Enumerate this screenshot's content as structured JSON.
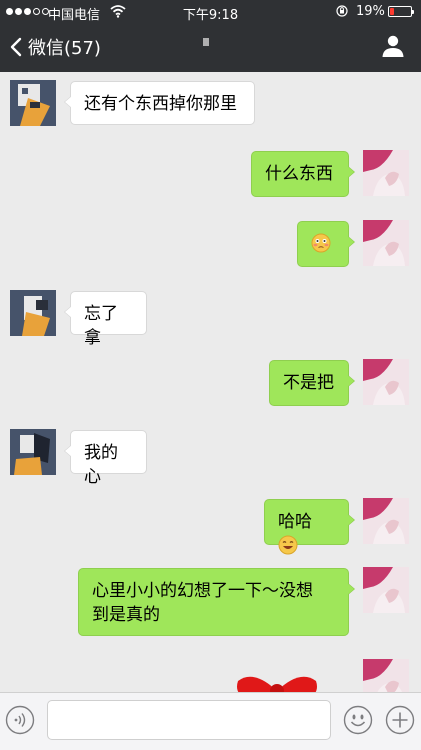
{
  "status_bar": {
    "carrier": "中国电信",
    "time": "下午9:18",
    "battery_percent": "19%",
    "battery_level": 0.19,
    "signal_bars": 3,
    "signal_total": 5,
    "colors": {
      "battery_low": "#ff3b30"
    }
  },
  "nav": {
    "back_label": "微信(57)",
    "icons": {
      "back": "chevron-left-icon",
      "contact": "person-icon"
    }
  },
  "colors": {
    "bubble_mine": "#9fe65a",
    "bubble_other": "#ffffff",
    "nav_bg": "#2f3134",
    "chat_bg": "#ebebeb"
  },
  "messages": [
    {
      "side": "left",
      "text": "还有个东西掉你那里"
    },
    {
      "side": "right",
      "text": "什么东西"
    },
    {
      "side": "right",
      "text": "",
      "emoji": "flushed-face-icon"
    },
    {
      "side": "left",
      "text": "忘了拿"
    },
    {
      "side": "right",
      "text": "不是把"
    },
    {
      "side": "left",
      "text": "我的心"
    },
    {
      "side": "right",
      "text": "哈哈",
      "emoji": "grinning-face-icon"
    },
    {
      "side": "right",
      "text_lines": [
        "心里小小的幻想了一下～没想",
        "到是真的"
      ]
    }
  ],
  "input_bar": {
    "placeholder": "",
    "icons": {
      "voice": "voice-icon",
      "emoji": "smiley-icon",
      "more": "plus-icon"
    }
  }
}
